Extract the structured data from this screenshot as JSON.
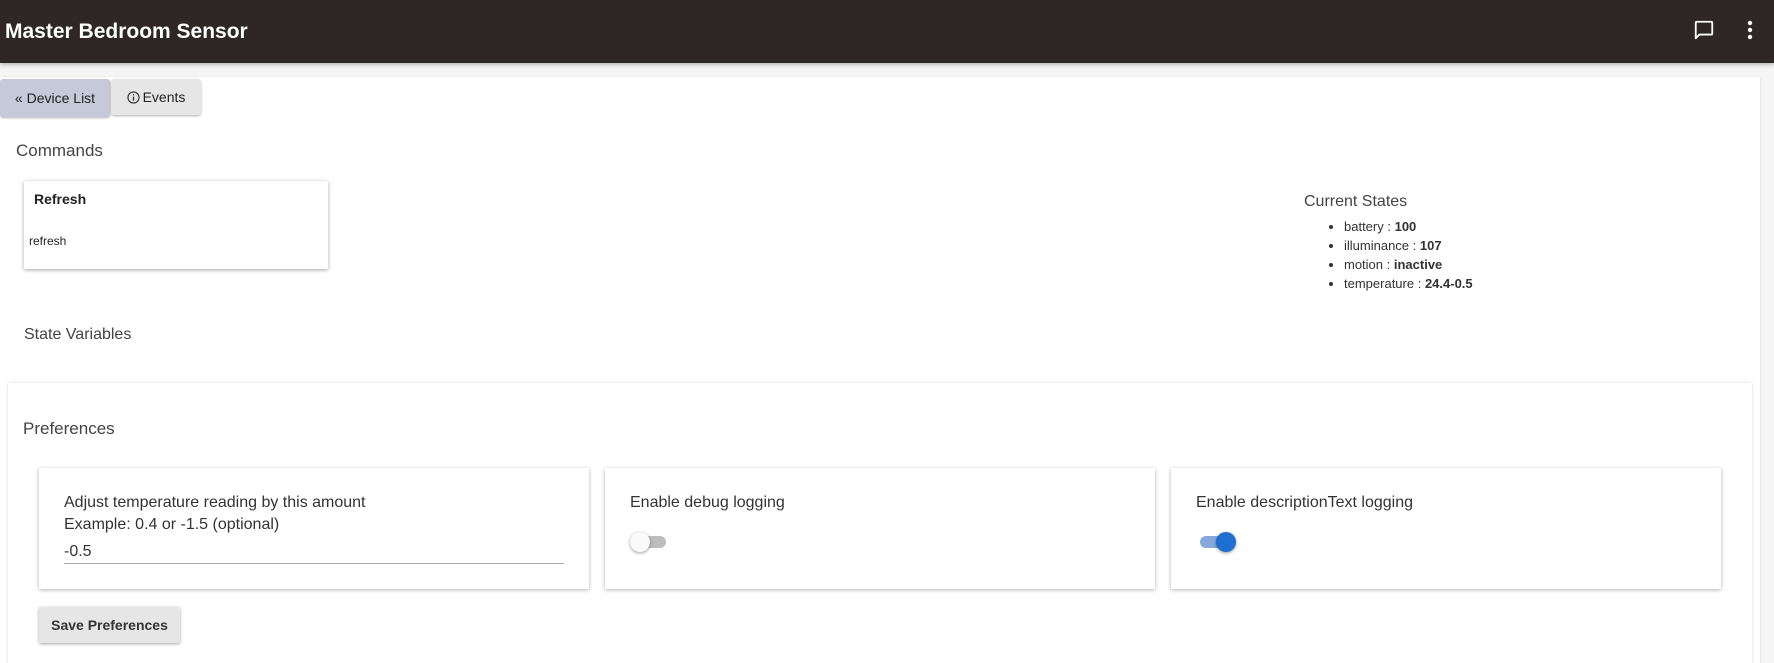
{
  "header": {
    "title": "Master Bedroom Sensor",
    "background": "#2f2725",
    "icons": [
      "message-icon",
      "more-vert-icon"
    ]
  },
  "nav": {
    "device_list_label": "« Device List",
    "events_label": "Events",
    "events_icon": "info-icon"
  },
  "commands": {
    "title": "Commands",
    "items": [
      {
        "name": "Refresh",
        "method": "refresh"
      }
    ]
  },
  "state_variables": {
    "title": "State Variables"
  },
  "current_states": {
    "title": "Current States",
    "items": [
      {
        "key": "battery",
        "value": "100"
      },
      {
        "key": "illuminance",
        "value": "107"
      },
      {
        "key": "motion",
        "value": "inactive"
      },
      {
        "key": "temperature",
        "value": "24.4-0.5"
      }
    ]
  },
  "preferences": {
    "title": "Preferences",
    "temp_offset": {
      "label_line1": "Adjust temperature reading by this amount",
      "label_line2": "Example: 0.4 or -1.5 (optional)",
      "value": "-0.5"
    },
    "debug_logging": {
      "label": "Enable debug logging",
      "enabled": false
    },
    "desc_logging": {
      "label": "Enable descriptionText logging",
      "enabled": true
    },
    "save_label": "Save Preferences",
    "accent_color": "#1e6fd0"
  }
}
